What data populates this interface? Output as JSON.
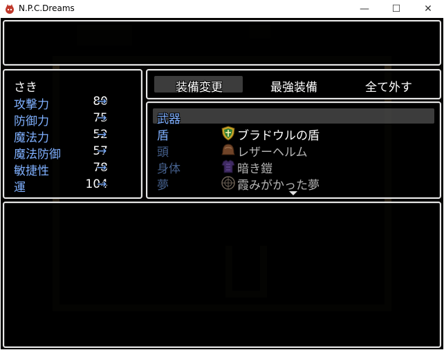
{
  "window": {
    "title": "N.P.C.Dreams",
    "minimize": "—",
    "maximize": "☐",
    "close": "✕"
  },
  "help": {
    "text": ""
  },
  "status": {
    "actor_name": "さき",
    "stats": [
      {
        "label": "攻撃力",
        "value": "80",
        "arrow": "→"
      },
      {
        "label": "防御力",
        "value": "75",
        "arrow": "→"
      },
      {
        "label": "魔法力",
        "value": "52",
        "arrow": "→"
      },
      {
        "label": "魔法防御",
        "value": "57",
        "arrow": "→"
      },
      {
        "label": "敏捷性",
        "value": "78",
        "arrow": "→"
      },
      {
        "label": "運",
        "value": "104",
        "arrow": "→"
      }
    ]
  },
  "commands": [
    {
      "label": "装備変更",
      "selected": true
    },
    {
      "label": "最強装備",
      "selected": false
    },
    {
      "label": "全て外す",
      "selected": false
    }
  ],
  "equipment": {
    "slots": [
      {
        "slot": "武器",
        "item": "",
        "icon": "",
        "enabled": true
      },
      {
        "slot": "盾",
        "item": "ブラドウルの盾",
        "icon": "shield-icon",
        "enabled": true
      },
      {
        "slot": "頭",
        "item": "レザーヘルム",
        "icon": "leather-helm-icon",
        "enabled": false
      },
      {
        "slot": "身体",
        "item": "暗き鎧",
        "icon": "dark-armor-icon",
        "enabled": false
      },
      {
        "slot": "夢",
        "item": "霞みがかった夢",
        "icon": "dream-icon",
        "enabled": false
      }
    ]
  },
  "items": {
    "list": []
  },
  "colors": {
    "system": "#7fb0ff",
    "normal": "#ffffff",
    "disabled": "#b4b4b4",
    "border": "#e8e8e8"
  }
}
